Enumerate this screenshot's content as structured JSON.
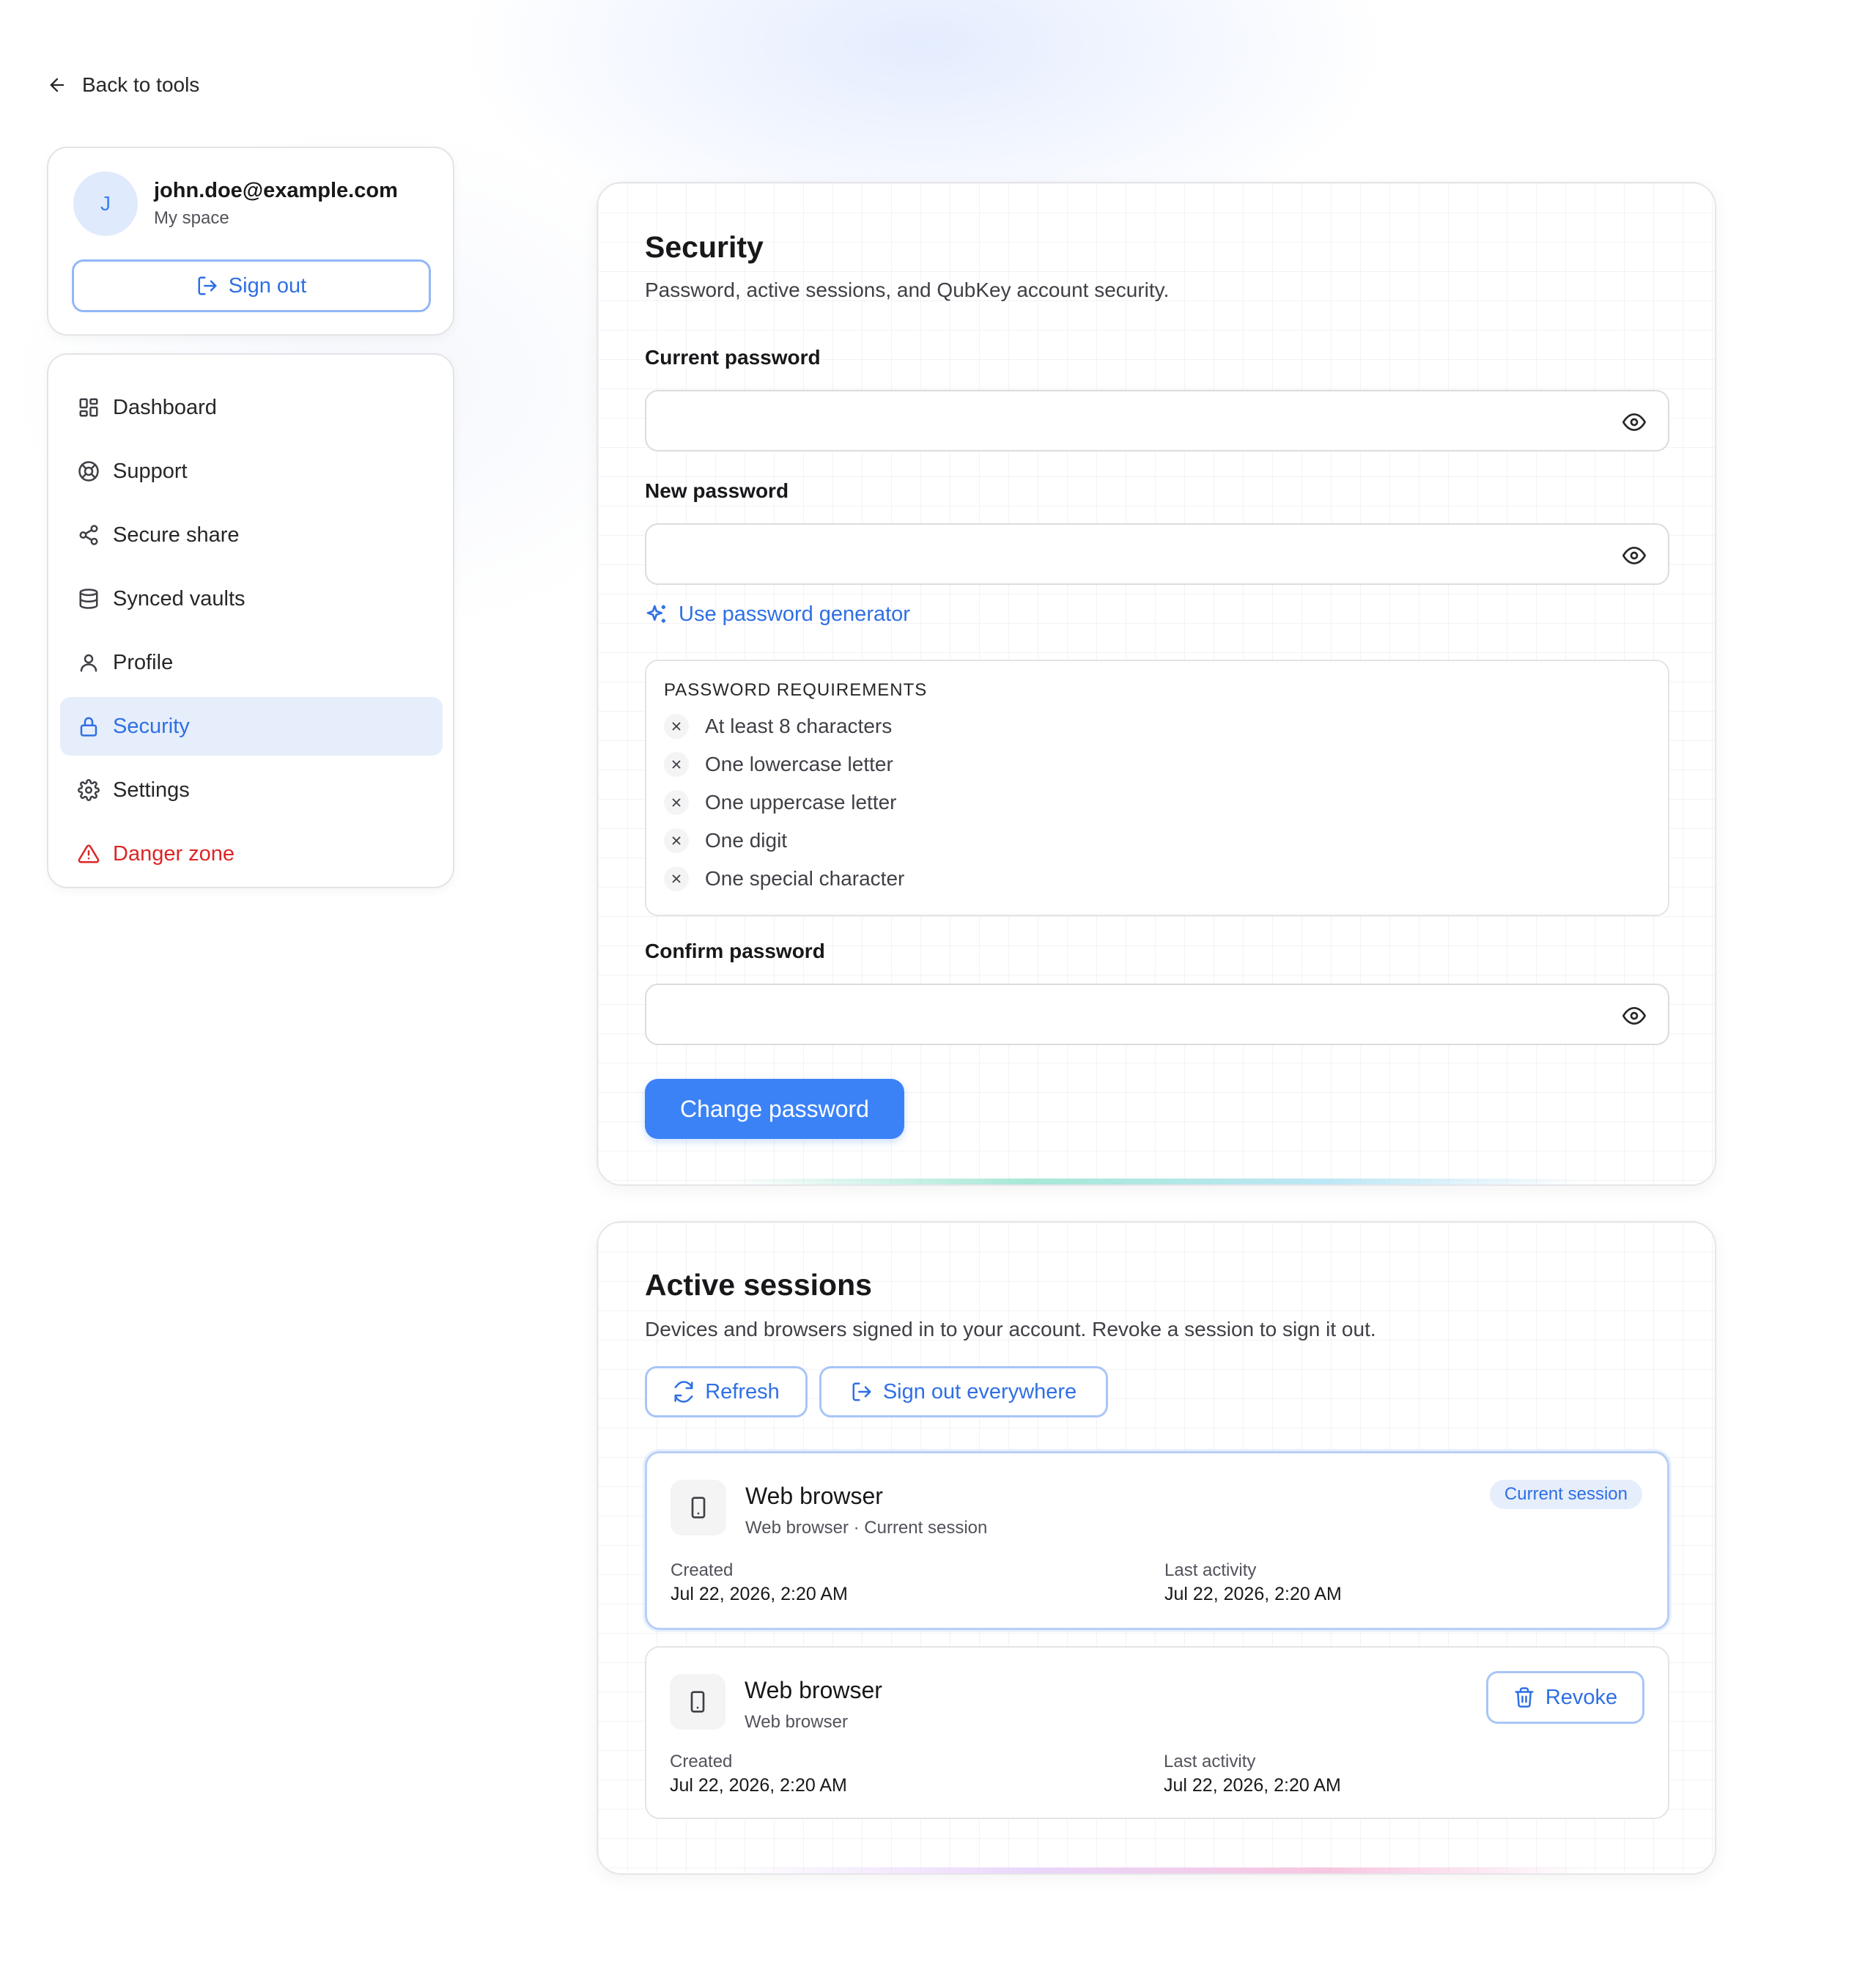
{
  "back": {
    "label": "Back to tools"
  },
  "account": {
    "avatar_initial": "J",
    "email": "john.doe@example.com",
    "space": "My space",
    "sign_out_label": "Sign out"
  },
  "sidebar": {
    "items": [
      {
        "label": "Dashboard",
        "icon": "dashboard-icon"
      },
      {
        "label": "Support",
        "icon": "lifebuoy-icon"
      },
      {
        "label": "Secure share",
        "icon": "share-icon"
      },
      {
        "label": "Synced vaults",
        "icon": "database-icon"
      },
      {
        "label": "Profile",
        "icon": "user-icon"
      },
      {
        "label": "Security",
        "icon": "lock-icon",
        "active": true
      },
      {
        "label": "Settings",
        "icon": "gear-icon"
      },
      {
        "label": "Danger zone",
        "icon": "warning-icon",
        "danger": true
      }
    ]
  },
  "security": {
    "title": "Security",
    "subtitle": "Password, active sessions, and QubKey account security.",
    "current_password": {
      "label": "Current password",
      "value": "",
      "placeholder": ""
    },
    "new_password": {
      "label": "New password",
      "value": "",
      "placeholder": ""
    },
    "generator_label": "Use password generator",
    "requirements": {
      "title": "PASSWORD REQUIREMENTS",
      "items": [
        {
          "label": "At least 8 characters",
          "met": false
        },
        {
          "label": "One lowercase letter",
          "met": false
        },
        {
          "label": "One uppercase letter",
          "met": false
        },
        {
          "label": "One digit",
          "met": false
        },
        {
          "label": "One special character",
          "met": false
        }
      ]
    },
    "confirm_password": {
      "label": "Confirm password",
      "value": "",
      "placeholder": ""
    },
    "submit_label": "Change password"
  },
  "sessions": {
    "title": "Active sessions",
    "subtitle": "Devices and browsers signed in to your account. Revoke a session to sign it out.",
    "refresh_label": "Refresh",
    "sign_out_everywhere_label": "Sign out everywhere",
    "created_label": "Created",
    "last_activity_label": "Last activity",
    "items": [
      {
        "name": "Web browser",
        "meta": "Web browser · Current session",
        "created": "Jul 22, 2026, 2:20 AM",
        "last_activity": "Jul 22, 2026, 2:20 AM",
        "current": true,
        "badge": "Current session"
      },
      {
        "name": "Web browser",
        "meta": "Web browser",
        "created": "Jul 22, 2026, 2:20 AM",
        "last_activity": "Jul 22, 2026, 2:20 AM",
        "current": false,
        "revoke_label": "Revoke"
      }
    ]
  },
  "colors": {
    "accent": "#3b82f6",
    "accent_text": "#2f6fe4",
    "danger": "#dc2626",
    "active_bg": "#e6eefc"
  }
}
